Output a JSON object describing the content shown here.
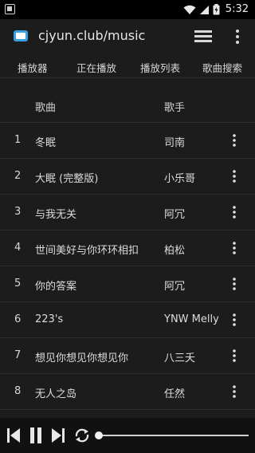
{
  "status_bar": {
    "time": "5:32"
  },
  "app_bar": {
    "title": "cjyun.club/music"
  },
  "tabs": [
    {
      "label": "播放器"
    },
    {
      "label": "正在播放"
    },
    {
      "label": "播放列表"
    },
    {
      "label": "歌曲搜索"
    }
  ],
  "list": {
    "header_song": "歌曲",
    "header_artist": "歌手",
    "rows": [
      {
        "num": "1",
        "song": "冬眠",
        "artist": "司南"
      },
      {
        "num": "2",
        "song": "大眠 (完整版)",
        "artist": "小乐哥"
      },
      {
        "num": "3",
        "song": "与我无关",
        "artist": "阿冗"
      },
      {
        "num": "4",
        "song": "世间美好与你环环相扣",
        "artist": "柏松"
      },
      {
        "num": "5",
        "song": "你的答案",
        "artist": "阿冗"
      },
      {
        "num": "6",
        "song": "223's",
        "artist": "YNW Melly"
      },
      {
        "num": "7",
        "song": "想见你想见你想见你",
        "artist": "八三夭"
      },
      {
        "num": "8",
        "song": "无人之岛",
        "artist": "任然"
      }
    ]
  },
  "player": {
    "progress": 0.0
  }
}
